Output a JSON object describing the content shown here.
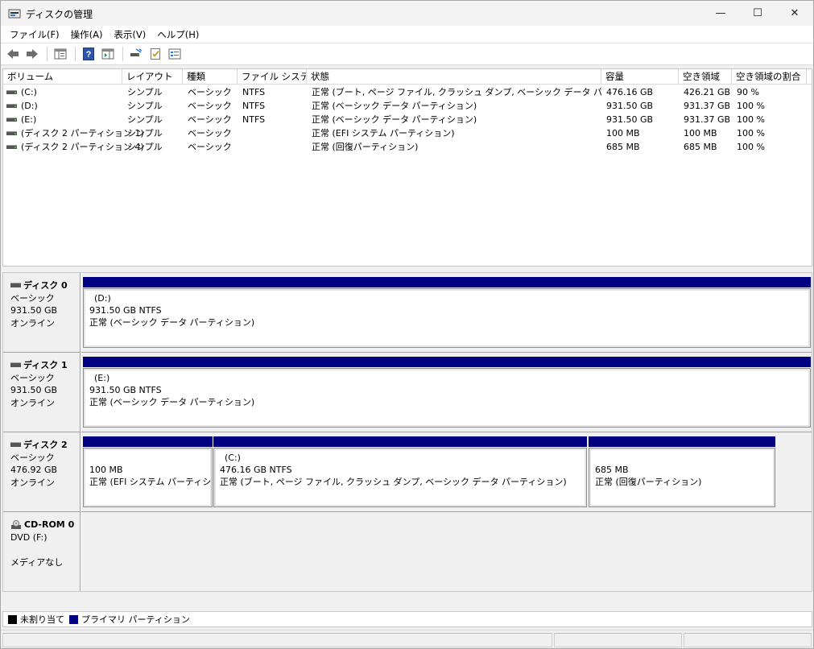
{
  "window": {
    "title": "ディスクの管理",
    "minimize_glyph": "—",
    "maximize_glyph": "☐",
    "close_glyph": "✕"
  },
  "menu": [
    "ファイル(F)",
    "操作(A)",
    "表示(V)",
    "ヘルプ(H)"
  ],
  "toolbar": {
    "icons": [
      "back-arrow-icon",
      "forward-arrow-icon",
      "console-tree-icon",
      "help-icon",
      "action-pane-icon",
      "connect-drive-icon",
      "checklist-icon",
      "properties-icon"
    ]
  },
  "volume_list": {
    "columns": [
      "ボリューム",
      "レイアウト",
      "種類",
      "ファイル システム",
      "状態",
      "容量",
      "空き領域",
      "空き領域の割合"
    ],
    "rows": [
      {
        "volume": "(C:)",
        "layout": "シンプル",
        "type": "ベーシック",
        "fs": "NTFS",
        "status": "正常 (ブート, ページ ファイル, クラッシュ ダンプ, ベーシック データ パーティション)",
        "capacity": "476.16 GB",
        "free": "426.21 GB",
        "pct": "90 %"
      },
      {
        "volume": "(D:)",
        "layout": "シンプル",
        "type": "ベーシック",
        "fs": "NTFS",
        "status": "正常 (ベーシック データ パーティション)",
        "capacity": "931.50 GB",
        "free": "931.37 GB",
        "pct": "100 %"
      },
      {
        "volume": "(E:)",
        "layout": "シンプル",
        "type": "ベーシック",
        "fs": "NTFS",
        "status": "正常 (ベーシック データ パーティション)",
        "capacity": "931.50 GB",
        "free": "931.37 GB",
        "pct": "100 %"
      },
      {
        "volume": "(ディスク 2 パーティション 1)",
        "layout": "シンプル",
        "type": "ベーシック",
        "fs": "",
        "status": "正常 (EFI システム パーティション)",
        "capacity": "100 MB",
        "free": "100 MB",
        "pct": "100 %"
      },
      {
        "volume": "(ディスク 2 パーティション 4)",
        "layout": "シンプル",
        "type": "ベーシック",
        "fs": "",
        "status": "正常 (回復パーティション)",
        "capacity": "685 MB",
        "free": "685 MB",
        "pct": "100 %"
      }
    ]
  },
  "disks": [
    {
      "name": "ディスク 0",
      "type": "ベーシック",
      "size": "931.50 GB",
      "state": "オンライン",
      "partitions": [
        {
          "label": "(D:)",
          "size_fs": "931.50 GB NTFS",
          "status": "正常 (ベーシック データ パーティション)"
        }
      ]
    },
    {
      "name": "ディスク 1",
      "type": "ベーシック",
      "size": "931.50 GB",
      "state": "オンライン",
      "partitions": [
        {
          "label": "(E:)",
          "size_fs": "931.50 GB NTFS",
          "status": "正常 (ベーシック データ パーティション)"
        }
      ]
    },
    {
      "name": "ディスク 2",
      "type": "ベーシック",
      "size": "476.92 GB",
      "state": "オンライン",
      "partitions": [
        {
          "label": "",
          "size_fs": "100 MB",
          "status": "正常 (EFI システム パーティション)"
        },
        {
          "label": "(C:)",
          "size_fs": "476.16 GB NTFS",
          "status": "正常 (ブート, ページ ファイル, クラッシュ ダンプ, ベーシック データ パーティション)"
        },
        {
          "label": "",
          "size_fs": "685 MB",
          "status": "正常 (回復パーティション)"
        }
      ]
    },
    {
      "name": "CD-ROM 0",
      "type": "DVD (F:)",
      "size": "",
      "state": "メディアなし",
      "partitions": []
    }
  ],
  "legend": [
    {
      "label": "未割り当て",
      "color": "#000000"
    },
    {
      "label": "プライマリ パーティション",
      "color": "#000080"
    }
  ],
  "colors": {
    "partition_bar": "#000080",
    "unallocated": "#000000"
  }
}
